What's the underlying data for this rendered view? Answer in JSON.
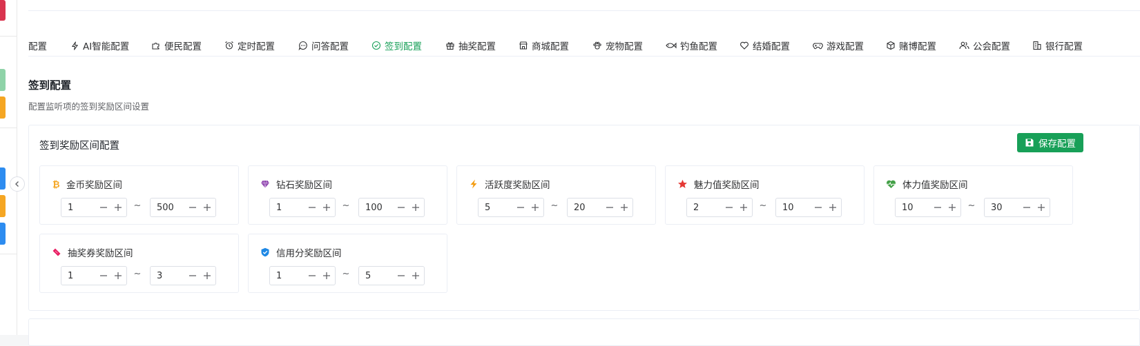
{
  "tabs": [
    {
      "label": "配置",
      "icon": "none",
      "active": false
    },
    {
      "label": "AI智能配置",
      "icon": "lightning-icon",
      "active": false
    },
    {
      "label": "便民配置",
      "icon": "puzzle-icon",
      "active": false
    },
    {
      "label": "定时配置",
      "icon": "alarm-clock-icon",
      "active": false
    },
    {
      "label": "问答配置",
      "icon": "chat-bubble-icon",
      "active": false
    },
    {
      "label": "签到配置",
      "icon": "check-circle-icon",
      "active": true
    },
    {
      "label": "抽奖配置",
      "icon": "gift-icon",
      "active": false
    },
    {
      "label": "商城配置",
      "icon": "store-icon",
      "active": false
    },
    {
      "label": "宠物配置",
      "icon": "paw-icon",
      "active": false
    },
    {
      "label": "钓鱼配置",
      "icon": "fish-icon",
      "active": false
    },
    {
      "label": "结婚配置",
      "icon": "heart-icon",
      "active": false
    },
    {
      "label": "游戏配置",
      "icon": "gamepad-icon",
      "active": false
    },
    {
      "label": "赌博配置",
      "icon": "cube-icon",
      "active": false
    },
    {
      "label": "公会配置",
      "icon": "users-icon",
      "active": false
    },
    {
      "label": "银行配置",
      "icon": "building-icon",
      "active": false
    }
  ],
  "page": {
    "title": "签到配置",
    "description": "配置监听项的签到奖励区间设置"
  },
  "card": {
    "title": "签到奖励区间配置",
    "save_label": "保存配置"
  },
  "ranges": [
    {
      "label": "金币奖励区间",
      "icon": "bitcoin-icon",
      "min": "1",
      "max": "500",
      "color": "#f5a623"
    },
    {
      "label": "钻石奖励区间",
      "icon": "diamond-icon",
      "min": "1",
      "max": "100",
      "color": "#8e44ad"
    },
    {
      "label": "活跃度奖励区间",
      "icon": "lightning-icon",
      "min": "5",
      "max": "20",
      "color": "#f39c12"
    },
    {
      "label": "魅力值奖励区间",
      "icon": "star-icon",
      "min": "2",
      "max": "10",
      "color": "#e53935"
    },
    {
      "label": "体力值奖励区间",
      "icon": "heartbeat-icon",
      "min": "10",
      "max": "30",
      "color": "#43a047"
    },
    {
      "label": "抽奖券奖励区间",
      "icon": "ticket-icon",
      "min": "1",
      "max": "3",
      "color": "#e91e63"
    },
    {
      "label": "信用分奖励区间",
      "icon": "shield-check-icon",
      "min": "1",
      "max": "5",
      "color": "#1e88e5"
    }
  ],
  "separator": "~",
  "colors": {
    "accent": "#18a058",
    "border": "#ebeef5"
  }
}
